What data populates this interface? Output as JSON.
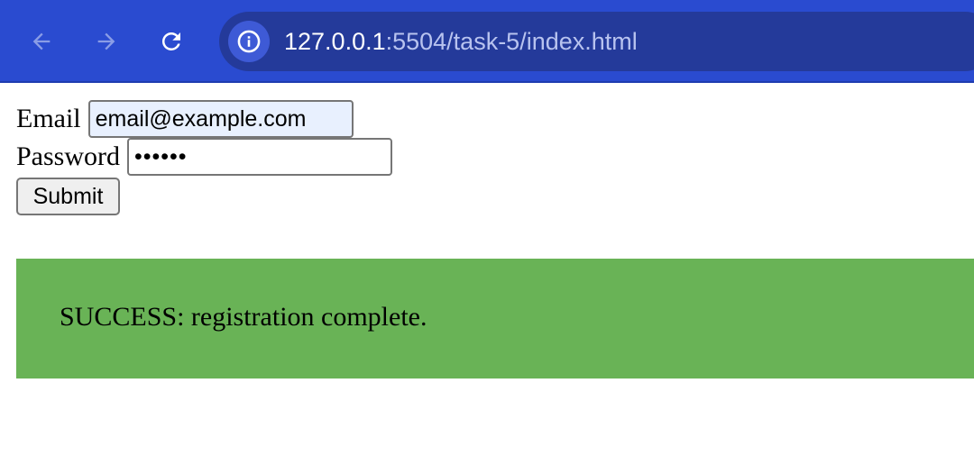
{
  "browser": {
    "url_host": "127.0.0.1",
    "url_rest": ":5504/task-5/index.html"
  },
  "form": {
    "email_label": "Email",
    "email_value": "email@example.com",
    "password_label": "Password",
    "password_value": "••••••",
    "submit_label": "Submit"
  },
  "alert": {
    "message": "SUCCESS: registration complete.",
    "color": "#69b356"
  },
  "icons": {
    "back": "arrow-left-icon",
    "forward": "arrow-right-icon",
    "reload": "reload-icon",
    "site_info": "info-icon"
  }
}
